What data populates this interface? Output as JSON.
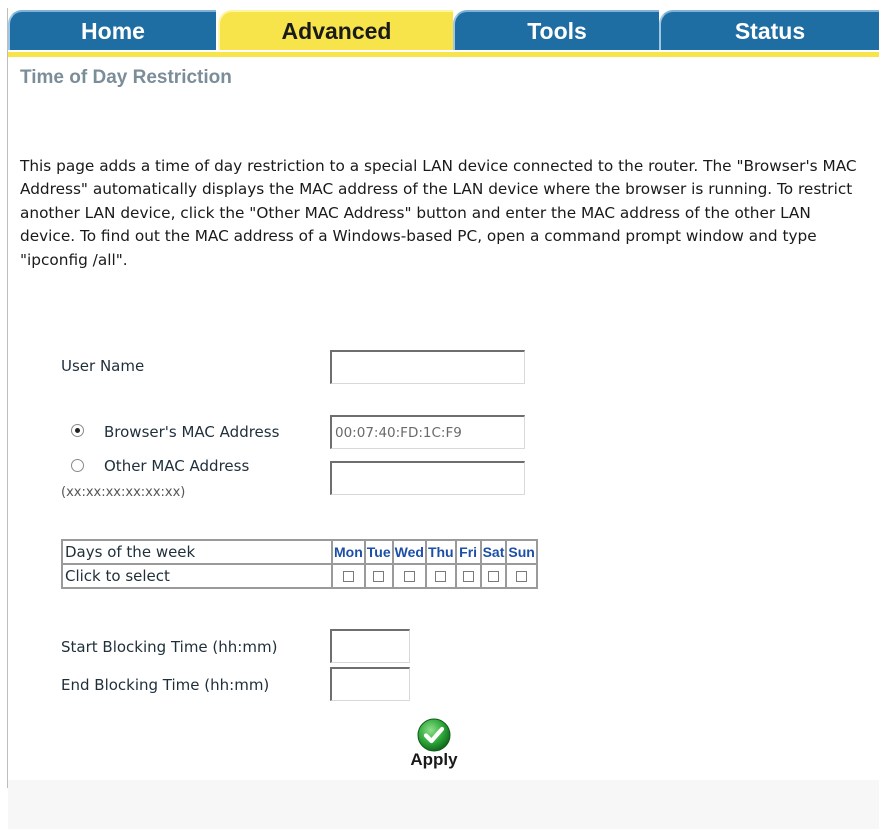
{
  "tabs": [
    {
      "label": "Home"
    },
    {
      "label": "Advanced",
      "active": true
    },
    {
      "label": "Tools"
    },
    {
      "label": "Status"
    }
  ],
  "page_title": "Time of Day Restriction",
  "intro_text": "This page adds a time of day restriction to a special LAN device connected to the router. The \"Browser's MAC Address\" automatically displays the MAC address of the LAN device where the browser is running. To restrict another LAN device, click the \"Other MAC Address\" button and enter the MAC address of the other LAN device. To find out the MAC address of a Windows-based PC, open a command prompt window and type \"ipconfig /all\".",
  "form": {
    "user_name_label": "User Name",
    "user_name_value": "",
    "browser_mac_label": "Browser's MAC Address",
    "browser_mac_value": "00:07:40:FD:1C:F9",
    "browser_mac_selected": true,
    "other_mac_label": "Other MAC Address",
    "other_mac_hint": "(xx:xx:xx:xx:xx:xx)",
    "other_mac_value": "",
    "days_header_label": "Days of the week",
    "click_to_select_label": "Click to select",
    "days": [
      "Mon",
      "Tue",
      "Wed",
      "Thu",
      "Fri",
      "Sat",
      "Sun"
    ],
    "start_label": "Start Blocking Time (hh:mm)",
    "start_value": "",
    "end_label": "End Blocking Time (hh:mm)",
    "end_value": ""
  },
  "apply_label": "Apply",
  "colors": {
    "tab_blue": "#1f6ea3",
    "tab_active_yellow": "#f6e44a",
    "title_gray": "#7a8d99",
    "day_header_blue": "#1c4fa6",
    "apply_green": "#2ea83a"
  }
}
